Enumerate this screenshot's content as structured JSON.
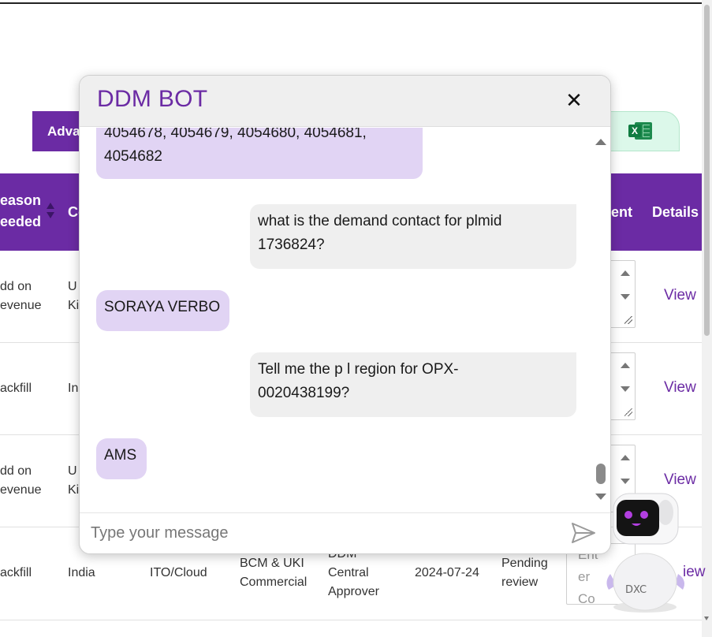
{
  "toolbar": {
    "advanced_label": "Adva",
    "excel_icon": "excel-icon"
  },
  "table": {
    "headers": {
      "reason_line1": "eason",
      "reason_line2": "eeded",
      "country": "Co",
      "comment": "ent",
      "details": "Details"
    },
    "rows": [
      {
        "reason_line1": "dd on",
        "reason_line2": "evenue",
        "country_line1": "U",
        "country_line2": "Ki",
        "view": "View"
      },
      {
        "reason_line1": "ackfill",
        "country_line1": "In",
        "view": "View"
      },
      {
        "reason_line1": "dd on",
        "reason_line2": "evenue",
        "country_line1": "U",
        "country_line2": "Ki",
        "view": "View"
      },
      {
        "reason_line1": "ackfill",
        "country": "India",
        "tower": "ITO/Cloud",
        "unit_line1": "BCM & UKI",
        "unit_line2": "Commercial",
        "approver_line1": "DDM",
        "approver_line2": "Central",
        "approver_line3": "Approver",
        "date": "2024-07-24",
        "status_line1": "Pending",
        "status_line2": "review",
        "comment_placeholder": "Enter Co",
        "view": "iew"
      }
    ]
  },
  "chat": {
    "title": "DDM BOT",
    "close_icon": "close-icon",
    "messages": [
      {
        "from": "bot",
        "text_line1": "4054678, 4054679, 4054680, 4054681,",
        "text_line2": "4054682"
      },
      {
        "from": "user",
        "text_line1": "what is the demand contact for plmid",
        "text_line2": "1736824?"
      },
      {
        "from": "bot",
        "text_line1": "SORAYA VERBO"
      },
      {
        "from": "user",
        "text_line1": "Tell me the p l region for OPX-",
        "text_line2": "0020438199?"
      },
      {
        "from": "bot",
        "text_line1": "AMS"
      }
    ],
    "input_placeholder": "Type your message",
    "send_icon": "send-icon"
  },
  "mascot": {
    "label": "DXC",
    "icon": "robot-icon"
  },
  "colors": {
    "brand": "#6b2ba4",
    "bot_bubble": "#e1d4f4",
    "user_bubble": "#efefef",
    "excel_green": "#1d8a4e"
  }
}
